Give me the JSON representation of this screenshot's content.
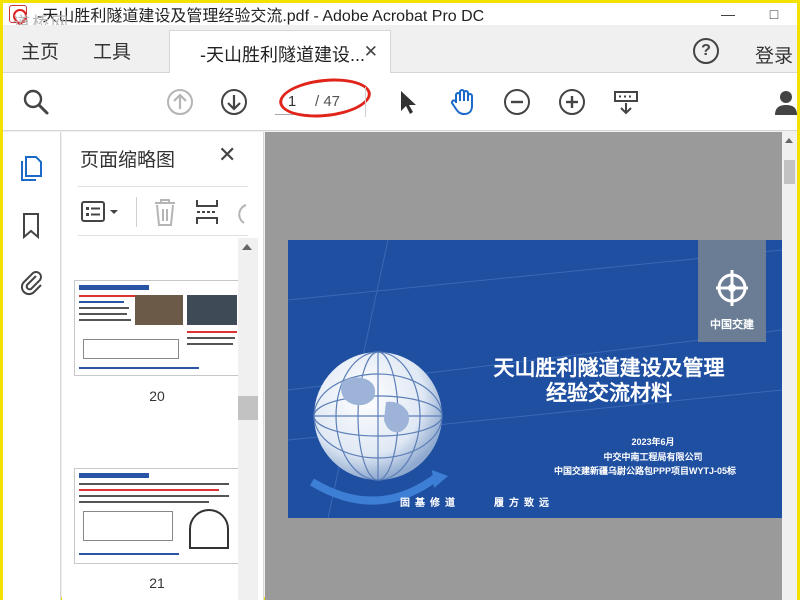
{
  "titlebar": {
    "watermark": "道桥网",
    "window_title": "-天山胜利隧道建设及管理经验交流.pdf - Adobe Acrobat Pro DC",
    "minimize": "—",
    "maximize": "□",
    "close": "✕"
  },
  "menu": {
    "home": "主页",
    "tools": "工具"
  },
  "tab": {
    "label": "-天山胜利隧道建设...",
    "close": "✕"
  },
  "header_right": {
    "help": "?",
    "login": "登录"
  },
  "toolbar": {
    "page_current": "1",
    "page_total": "/ 47",
    "icons": [
      "search-icon",
      "page-up-icon",
      "page-down-icon",
      "select-pointer-icon",
      "hand-tool-icon",
      "zoom-out-icon",
      "zoom-in-icon",
      "page-display-icon",
      "share-user-icon"
    ]
  },
  "left_rail": {
    "icons": [
      "page-thumbnails-icon",
      "bookmark-icon",
      "attachment-icon"
    ]
  },
  "thumbnail_panel": {
    "title": "页面缩略图",
    "close": "✕",
    "pages": [
      {
        "label": "20"
      },
      {
        "label": "21"
      }
    ]
  },
  "slide": {
    "logo_text": "中国交建",
    "title_line1": "天山胜利隧道建设及管理",
    "title_line2": "经验交流材料",
    "date": "2023年6月",
    "company": "中交中南工程局有限公司",
    "project": "中国交建新疆乌尉公路包PPP项目WYTJ-05标",
    "slogan_left": "固基修道",
    "slogan_right": "履方致远",
    "colors": {
      "background": "#1f4fa0",
      "logo_box": "#6a7d95"
    }
  }
}
